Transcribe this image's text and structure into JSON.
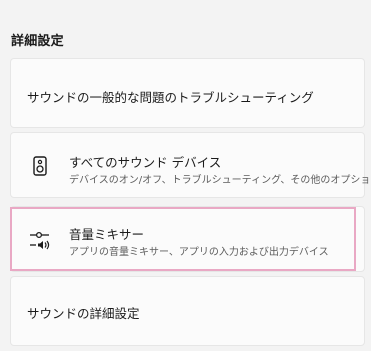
{
  "section_title": "詳細設定",
  "items": [
    {
      "label": "サウンドの一般的な問題のトラブルシューティング",
      "icon": "none"
    },
    {
      "title": "すべてのサウンド デバイス",
      "subtitle": "デバイスのオン/オフ、トラブルシューティング、その他のオプション",
      "icon": "speaker-device-icon"
    },
    {
      "title": "音量ミキサー",
      "subtitle": "アプリの音量ミキサー、アプリの入力および出力デバイス",
      "icon": "volume-mixer-icon"
    },
    {
      "label": "サウンドの詳細設定",
      "icon": "none"
    }
  ],
  "colors": {
    "background": "#f3f3f3",
    "card": "#fbfbfb",
    "highlight_border": "#e9a8c4",
    "subtitle_text": "#5c5c5c"
  }
}
